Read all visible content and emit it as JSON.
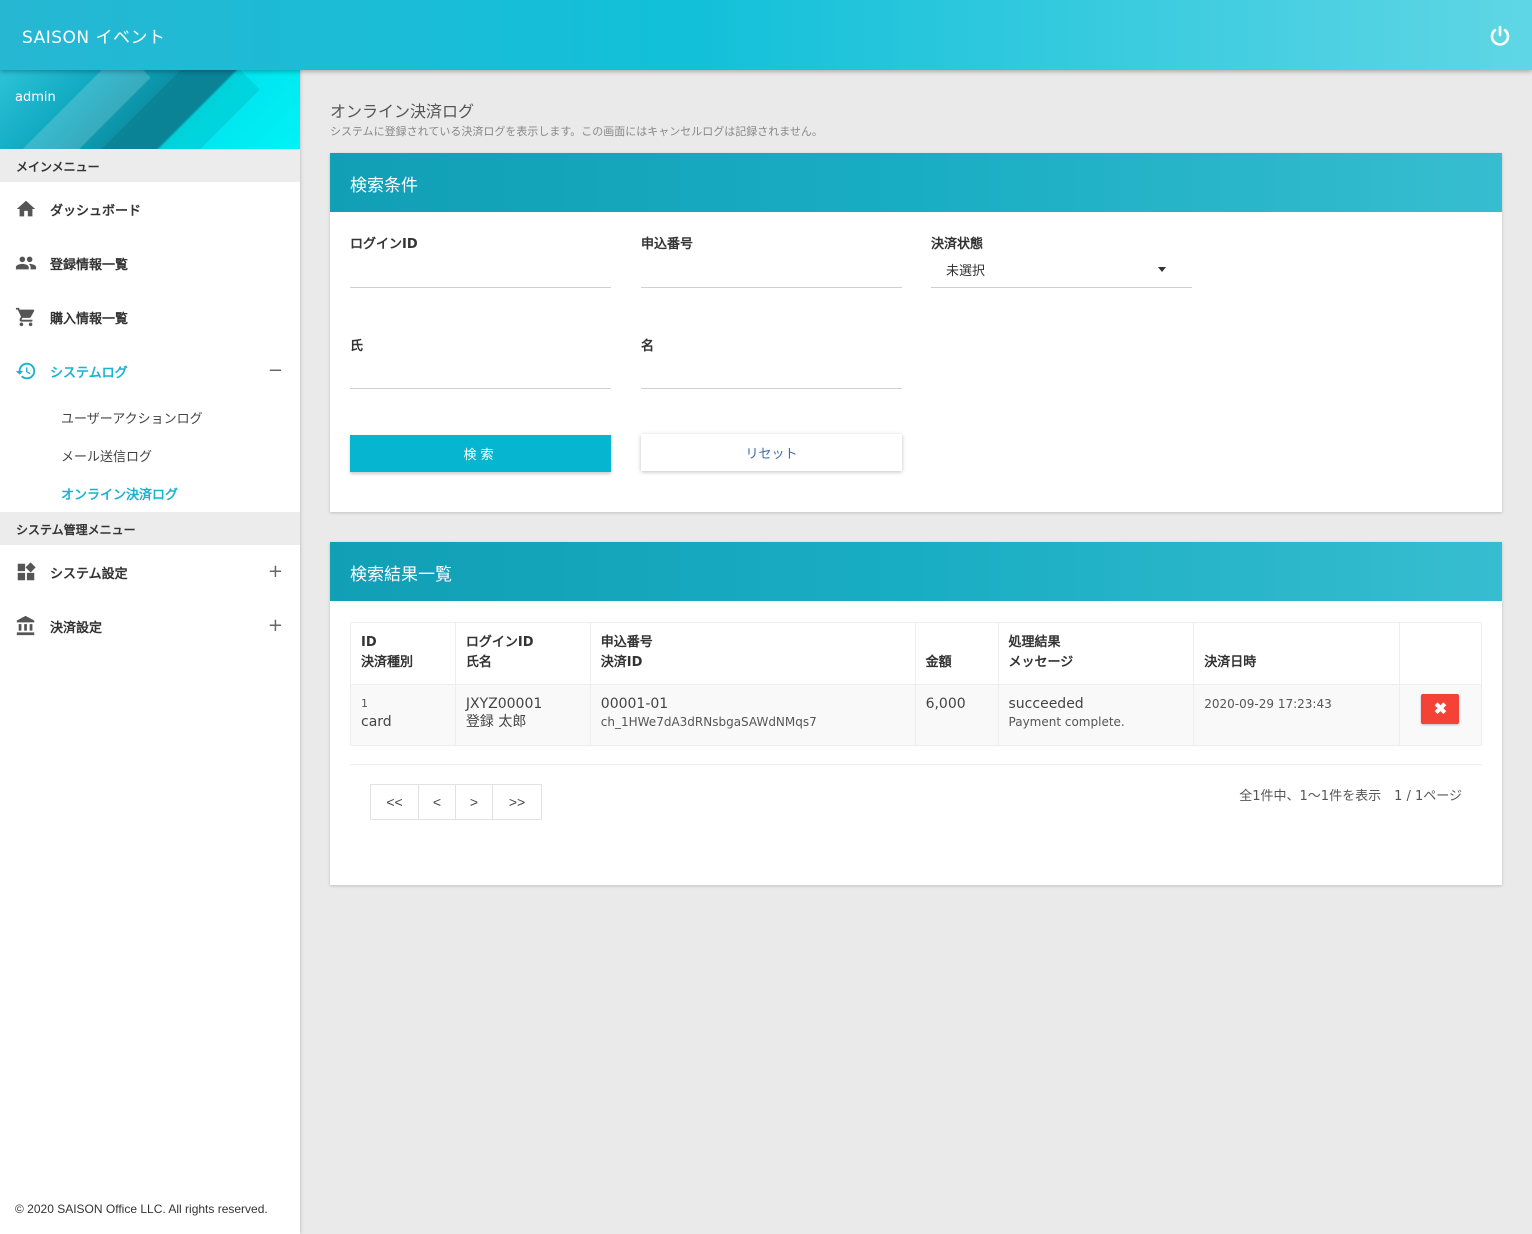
{
  "header": {
    "title": "SAISON イベント",
    "power_icon": "power-icon"
  },
  "sidebar": {
    "user": "admin",
    "main_menu_label": "メインメニュー",
    "items": [
      {
        "label": "ダッシュボード",
        "icon": "home-icon"
      },
      {
        "label": "登録情報一覧",
        "icon": "people-icon"
      },
      {
        "label": "購入情報一覧",
        "icon": "cart-icon"
      },
      {
        "label": "システムログ",
        "icon": "history-icon",
        "toggle": "−"
      }
    ],
    "system_log_sub": [
      {
        "label": "ユーザーアクションログ"
      },
      {
        "label": "メール送信ログ"
      },
      {
        "label": "オンライン決済ログ"
      }
    ],
    "admin_menu_label": "システム管理メニュー",
    "admin_items": [
      {
        "label": "システム設定",
        "icon": "dashboard-icon",
        "toggle": "+"
      },
      {
        "label": "決済設定",
        "icon": "bank-icon",
        "toggle": "+"
      }
    ],
    "copyright": "© 2020 SAISON Office LLC. All rights reserved."
  },
  "page": {
    "title": "オンライン決済ログ",
    "description": "システムに登録されている決済ログを表示します。この画面にはキャンセルログは記録されません。"
  },
  "search": {
    "header": "検索条件",
    "login_id_label": "ログインID",
    "login_id_value": "",
    "apply_no_label": "申込番号",
    "apply_no_value": "",
    "status_label": "決済状態",
    "status_value": "未選択",
    "last_name_label": "氏",
    "last_name_value": "",
    "first_name_label": "名",
    "first_name_value": "",
    "search_button": "検索",
    "reset_button": "リセット"
  },
  "results": {
    "header": "検索結果一覧",
    "columns": [
      {
        "line1": "ID",
        "line2": "決済種別"
      },
      {
        "line1": "ログインID",
        "line2": "氏名"
      },
      {
        "line1": "申込番号",
        "line2": "決済ID"
      },
      {
        "line1": "",
        "line2": "金額"
      },
      {
        "line1": "処理結果",
        "line2": "メッセージ"
      },
      {
        "line1": "",
        "line2": "決済日時"
      },
      {
        "line1": "",
        "line2": ""
      }
    ],
    "rows": [
      {
        "id": "1",
        "type": "card",
        "login_id": "JXYZ00001",
        "name": "登録 太郎",
        "apply_no": "00001-01",
        "payment_id": "ch_1HWe7dA3dRNsbgaSAWdNMqs7",
        "amount": "6,000",
        "result": "succeeded",
        "message": "Payment complete.",
        "datetime": "2020-09-29 17:23:43",
        "delete_label": "✖"
      }
    ],
    "pager": {
      "first": "<<",
      "prev": "<",
      "next": ">",
      "last": ">>"
    },
    "pager_info": "全1件中、1〜1件を表示　1 / 1ページ"
  }
}
